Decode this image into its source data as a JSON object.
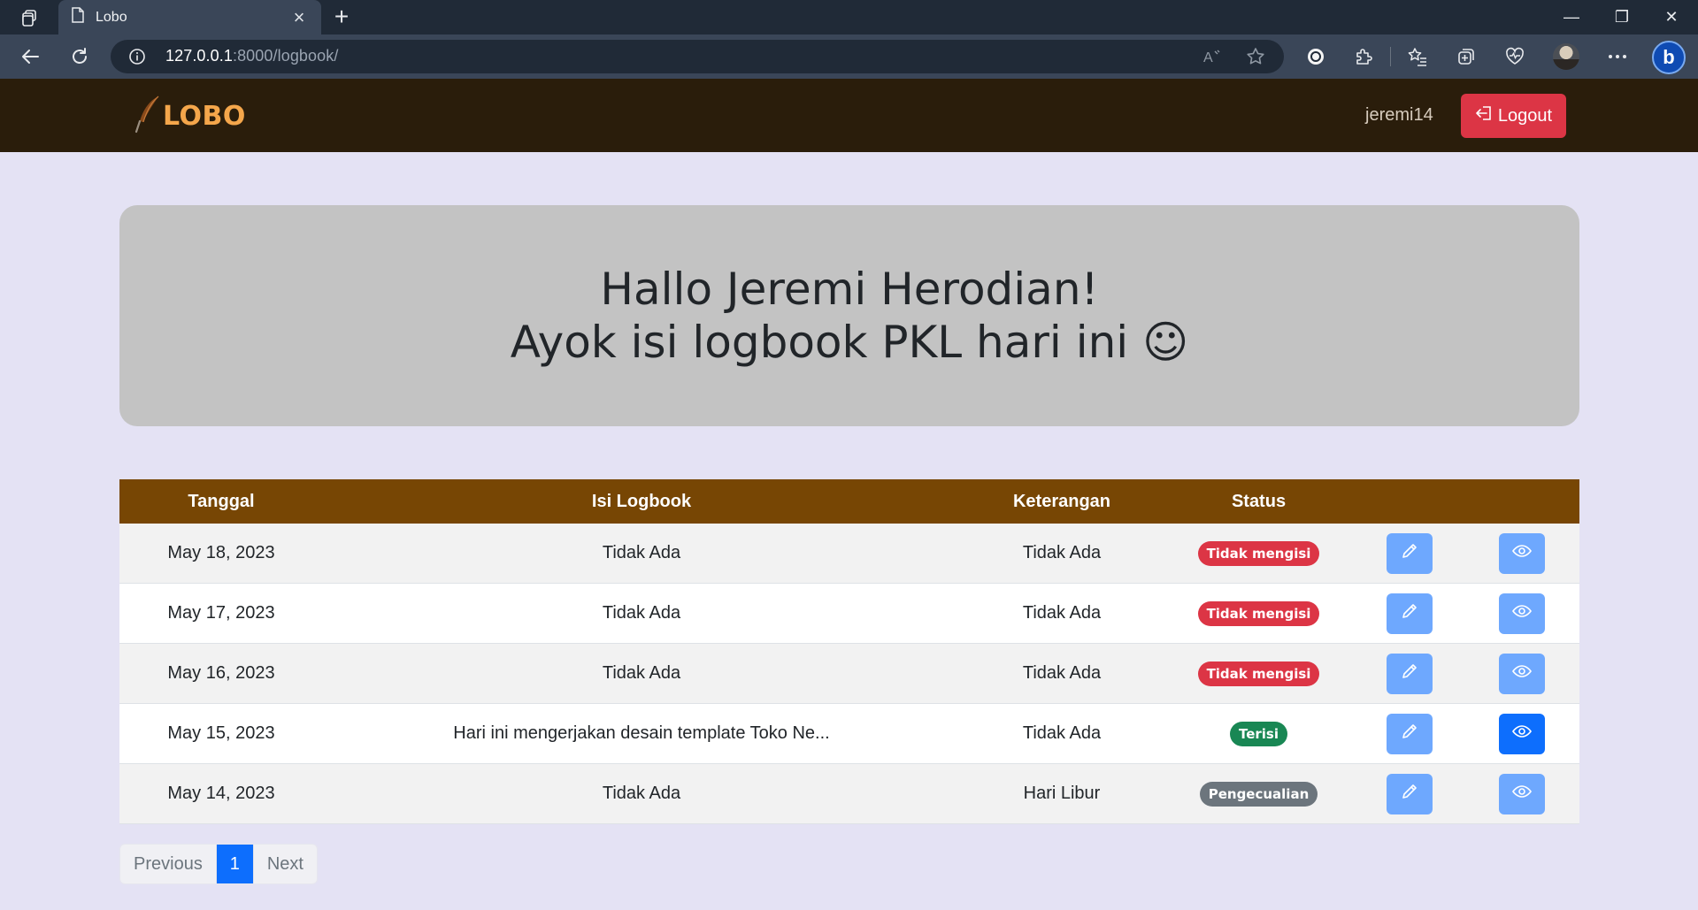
{
  "browser": {
    "tab_title": "Lobo",
    "tab_close": "×",
    "new_tab": "+",
    "url_host": "127.0.0.1",
    "url_rest": ":8000/logbook/",
    "window_controls": {
      "minimize": "—",
      "restore": "❐",
      "close": "✕"
    }
  },
  "navbar": {
    "brand": "LOBO",
    "username": "jeremi14",
    "logout_label": "Logout"
  },
  "hero": {
    "line1": "Hallo Jeremi Herodian!",
    "line2": "Ayok isi logbook PKL hari ini ☺"
  },
  "table": {
    "headers": {
      "tanggal": "Tanggal",
      "isi": "Isi Logbook",
      "keterangan": "Keterangan",
      "status": "Status"
    },
    "rows": [
      {
        "tanggal": "May 18, 2023",
        "isi": "Tidak Ada",
        "keterangan": "Tidak Ada",
        "status": "Tidak mengisi"
      },
      {
        "tanggal": "May 17, 2023",
        "isi": "Tidak Ada",
        "keterangan": "Tidak Ada",
        "status": "Tidak mengisi"
      },
      {
        "tanggal": "May 16, 2023",
        "isi": "Tidak Ada",
        "keterangan": "Tidak Ada",
        "status": "Tidak mengisi"
      },
      {
        "tanggal": "May 15, 2023",
        "isi": "Hari ini mengerjakan desain template Toko Ne...",
        "keterangan": "Tidak Ada",
        "status": "Terisi"
      },
      {
        "tanggal": "May 14, 2023",
        "isi": "Tidak Ada",
        "keterangan": "Hari Libur",
        "status": "Pengecualian"
      }
    ]
  },
  "pagination": {
    "previous": "Previous",
    "current": "1",
    "next": "Next"
  },
  "colors": {
    "navbar_bg": "#2a1d0b",
    "brand": "#f4a64b",
    "table_header": "#774604",
    "logout": "#dc3545",
    "status_danger": "#dc3545",
    "status_success": "#198754",
    "status_secondary": "#6c757d",
    "primary": "#0d6efd"
  }
}
